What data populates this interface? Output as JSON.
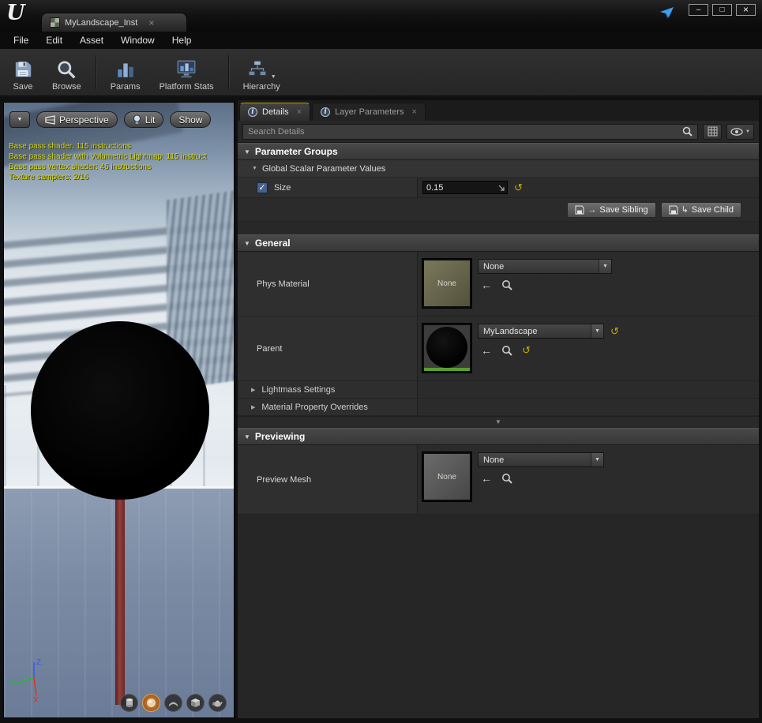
{
  "glyphs": {
    "logo": "U",
    "minimize": "–",
    "maximize": "□",
    "close": "×",
    "dropdown": "▼",
    "expanded": "▼",
    "collapsed": "▶",
    "back": "←",
    "reset": "↺",
    "check": "✓",
    "info": "i",
    "sibling_arrow": "→",
    "child_arrow": "↳"
  },
  "titlebar": {
    "tab_title": "MyLandscape_Inst"
  },
  "menubar": {
    "items": [
      "File",
      "Edit",
      "Asset",
      "Window",
      "Help"
    ]
  },
  "toolbar": {
    "save": "Save",
    "browse": "Browse",
    "params": "Params",
    "platform_stats": "Platform Stats",
    "hierarchy": "Hierarchy"
  },
  "viewport": {
    "perspective": "Perspective",
    "lit": "Lit",
    "show": "Show",
    "stats": [
      "Base pass shader: 115 instructions",
      "Base pass shader with Volumetric Lightmap: 115 instruct",
      "Base pass vertex shader: 46 instructions",
      "Texture samplers: 2/16"
    ],
    "axis": {
      "x": "X",
      "y": "Y",
      "z": "Z"
    }
  },
  "details": {
    "tab_details": "Details",
    "tab_layer_parameters": "Layer Parameters",
    "search_placeholder": "Search Details",
    "parameter_groups": {
      "header": "Parameter Groups",
      "global_scalar": "Global Scalar Parameter Values",
      "size_label": "Size",
      "size_value": "0.15",
      "save_sibling": "Save Sibling",
      "save_child": "Save Child"
    },
    "general": {
      "header": "General",
      "phys_material_label": "Phys Material",
      "phys_material_thumb": "None",
      "phys_material_value": "None",
      "parent_label": "Parent",
      "parent_value": "MyLandscape",
      "lightmass": "Lightmass Settings",
      "material_overrides": "Material Property Overrides"
    },
    "previewing": {
      "header": "Previewing",
      "preview_mesh_label": "Preview Mesh",
      "preview_mesh_thumb": "None",
      "preview_mesh_value": "None"
    }
  },
  "colors": {
    "accent_yellow": "#c8a800",
    "stats_yellow": "#d6d600",
    "selected_orange": "#c87a2a",
    "panel_bg": "#2b2b2b"
  }
}
